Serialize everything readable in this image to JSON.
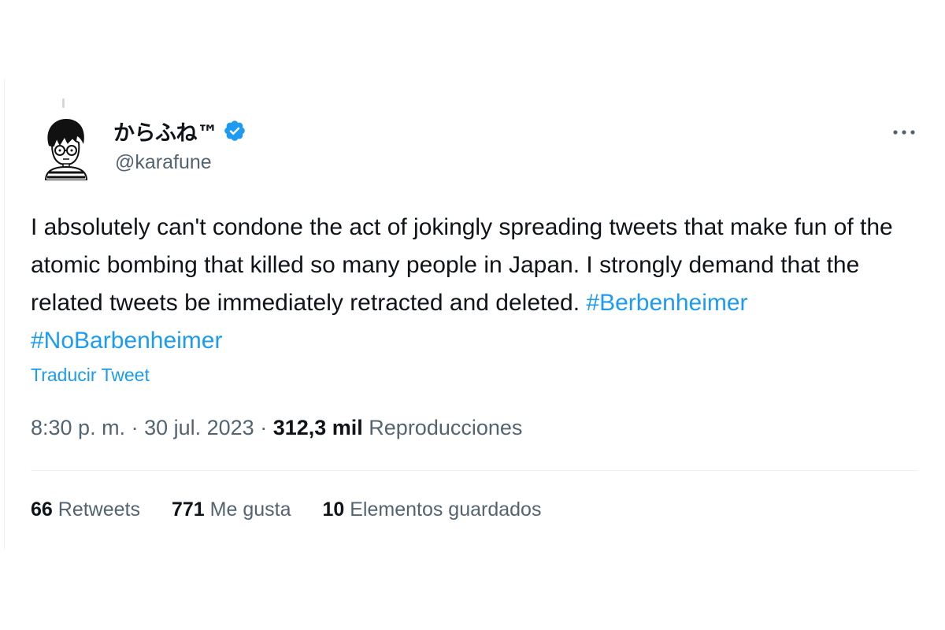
{
  "tweet": {
    "author": {
      "display_name": "からふね™",
      "handle": "@karafune",
      "verified_icon": "verified-badge-icon",
      "avatar": "avatar"
    },
    "more_icon": "more-icon",
    "text": {
      "body": "I absolutely can't condone the act of jokingly spreading tweets that make fun of the atomic bombing that killed so many people in Japan. I strongly demand that the related tweets be immediately retracted and deleted. ",
      "hashtags": [
        "#Berbenheimer",
        "#NoBarbenheimer"
      ]
    },
    "translate_label": "Traducir Tweet",
    "meta": {
      "time": "8:30 p. m.",
      "sep1": " · ",
      "date": "30 jul. 2023",
      "sep2": " · ",
      "views_count": "312,3 mil",
      "views_label": " Reproducciones"
    },
    "stats": {
      "retweets_count": "66",
      "retweets_label": " Retweets",
      "likes_count": "771",
      "likes_label": " Me gusta",
      "bookmarks_count": "10",
      "bookmarks_label": " Elementos guardados"
    }
  },
  "colors": {
    "accent": "#1d9bf0",
    "text_primary": "#0f1419",
    "text_secondary": "#536471",
    "divider": "#eff3f4"
  }
}
